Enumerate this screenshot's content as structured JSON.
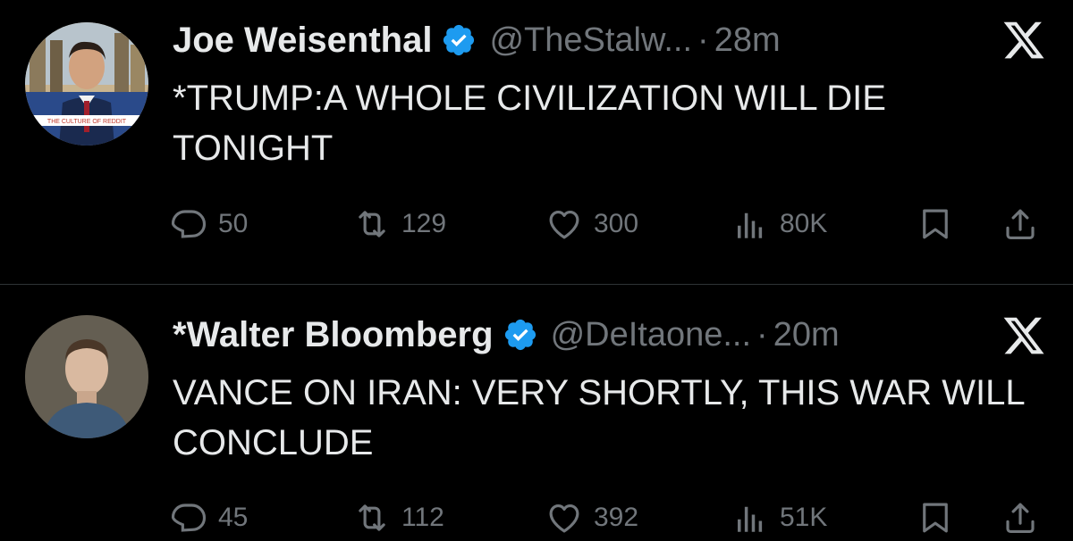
{
  "tweets": [
    {
      "author_name": "Joe Weisenthal",
      "handle": "@TheStalw...",
      "separator": "·",
      "time": "28m",
      "text": "*TRUMP:A WHOLE CIVILIZATION WILL DIE TONIGHT",
      "avatar_caption": "THE CULTURE OF REDDIT",
      "stats": {
        "replies": "50",
        "retweets": "129",
        "likes": "300",
        "views": "80K"
      }
    },
    {
      "author_name": "*Walter Bloomberg",
      "handle": "@DeItaone...",
      "separator": "·",
      "time": "20m",
      "text": "VANCE ON IRAN: VERY SHORTLY, THIS WAR WILL CONCLUDE",
      "stats": {
        "replies": "45",
        "retweets": "112",
        "likes": "392",
        "views": "51K"
      }
    }
  ],
  "icons": {
    "verified": "verified-badge-icon",
    "x_logo": "x-logo-icon",
    "reply": "reply-icon",
    "retweet": "retweet-icon",
    "like": "heart-icon",
    "views": "views-icon",
    "bookmark": "bookmark-icon",
    "share": "share-icon"
  },
  "colors": {
    "background": "#000000",
    "text": "#e7e9ea",
    "muted": "#71767b",
    "verified": "#1d9bf0",
    "divider": "#2f3336"
  }
}
